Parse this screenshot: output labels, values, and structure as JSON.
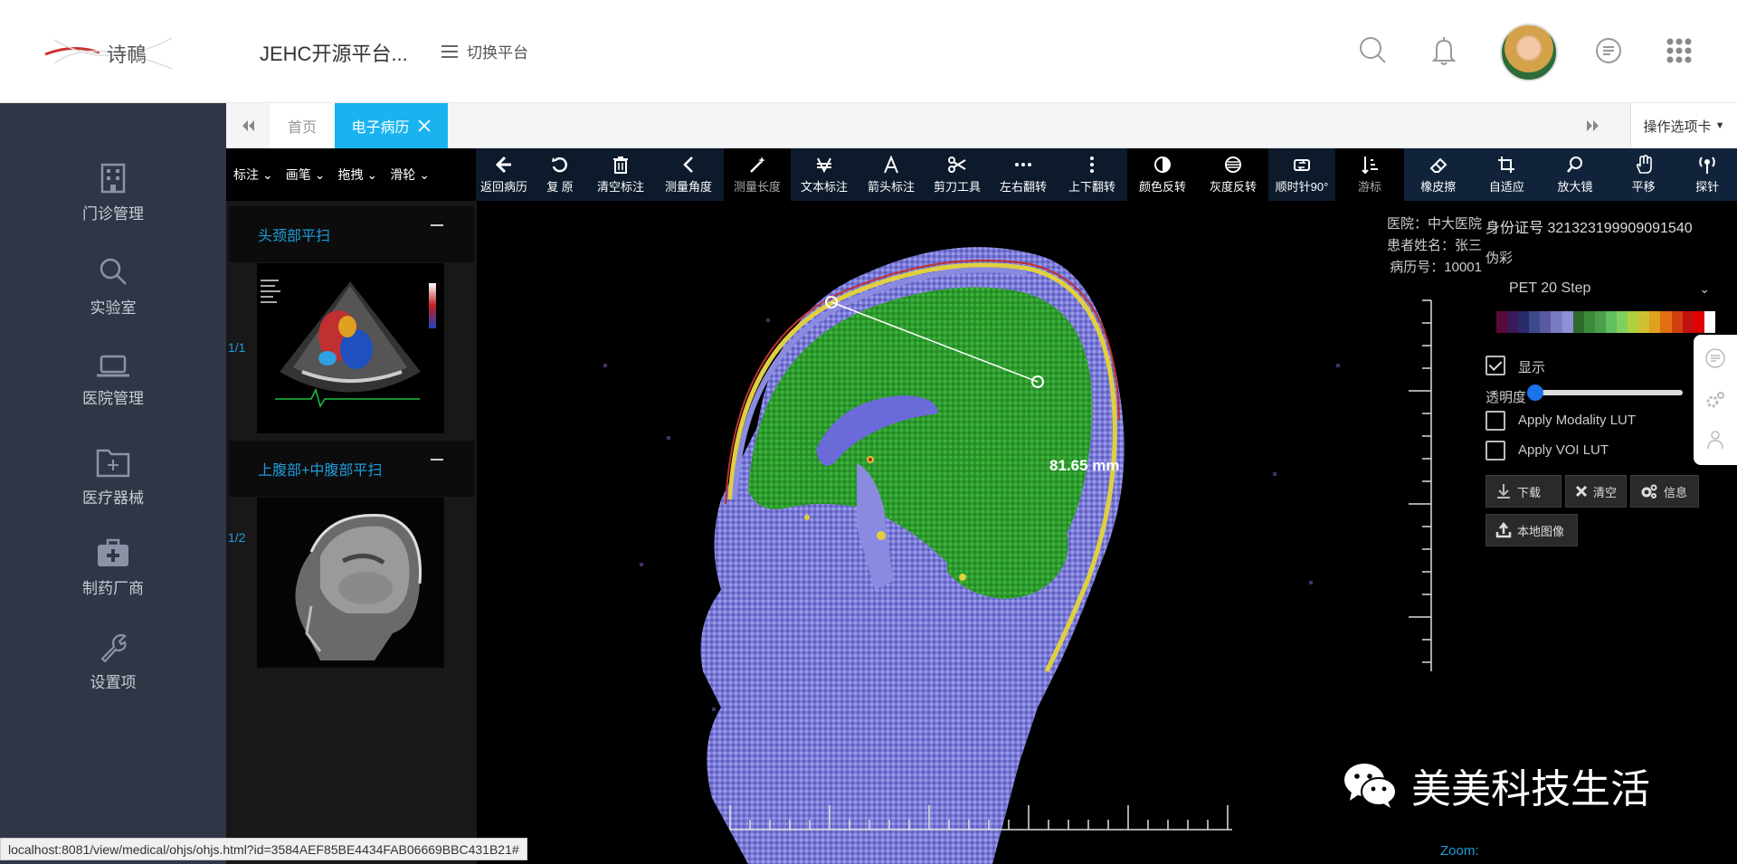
{
  "app": {
    "title": "JEHC开源平台...",
    "switch_label": "切换平台"
  },
  "sidebar": {
    "items": [
      {
        "label": "门诊管理",
        "icon": "building-icon"
      },
      {
        "label": "实验室",
        "icon": "search-icon"
      },
      {
        "label": "医院管理",
        "icon": "laptop-icon"
      },
      {
        "label": "医疗器械",
        "icon": "folder-icon"
      },
      {
        "label": "制药厂商",
        "icon": "medkit-icon"
      },
      {
        "label": "设置项",
        "icon": "wrench-icon"
      }
    ]
  },
  "tabs": {
    "home": "首页",
    "active": "电子病历",
    "ops": "操作选项卡"
  },
  "toolbar": {
    "dropdowns": [
      "标注",
      "画笔",
      "拖拽",
      "滑轮"
    ],
    "tools": [
      {
        "label": "返回病历",
        "icon": "arrow-left-icon"
      },
      {
        "label": "复 原",
        "icon": "undo-icon"
      },
      {
        "label": "清空标注",
        "icon": "trash-icon"
      },
      {
        "label": "测量角度",
        "icon": "angle-icon"
      },
      {
        "label": "测量长度",
        "icon": "magic-wand-icon"
      },
      {
        "label": "文本标注",
        "icon": "text-annotation-icon"
      },
      {
        "label": "箭头标注",
        "icon": "letter-a-icon"
      },
      {
        "label": "剪刀工具",
        "icon": "scissors-icon"
      },
      {
        "label": "左右翻转",
        "icon": "dots-horizontal-icon"
      },
      {
        "label": "上下翻转",
        "icon": "dots-vertical-icon"
      },
      {
        "label": "颜色反转",
        "icon": "contrast-icon"
      },
      {
        "label": "灰度反转",
        "icon": "grayscale-icon"
      },
      {
        "label": "顺时针90°",
        "icon": "rotate-icon"
      },
      {
        "label": "游标",
        "icon": "cursor-sort-icon"
      },
      {
        "label": "橡皮擦",
        "icon": "eraser-icon"
      },
      {
        "label": "自适应",
        "icon": "crop-icon"
      },
      {
        "label": "放大镜",
        "icon": "magnifier-icon"
      },
      {
        "label": "平移",
        "icon": "hand-icon"
      },
      {
        "label": "探针",
        "icon": "probe-icon"
      }
    ]
  },
  "series": [
    {
      "title": "头颈部平扫",
      "count": "1/1"
    },
    {
      "title": "上腹部+中腹部平扫",
      "count": "1/2"
    }
  ],
  "viewer": {
    "hospital": "医院：中大医院",
    "patient": "患者姓名：张三",
    "record": "病历号：10001",
    "measurement": "81.65 mm",
    "zoom": "Zoom:"
  },
  "panel": {
    "id_label": "身份证号 321323199909091540",
    "pseudo_color": "伪彩",
    "lut_selected": "PET 20 Step",
    "show_label": "显示",
    "opacity_label": "透明度",
    "modality_lut": "Apply Modality LUT",
    "voi_lut": "Apply VOI LUT",
    "download": "下载",
    "clear": "清空",
    "info": "信息",
    "local_image": "本地图像",
    "colors": [
      "#5a0a3a",
      "#3a1a5a",
      "#2a2a6a",
      "#3a4a8a",
      "#5a5aa0",
      "#7a7ac0",
      "#9090d8",
      "#2a6a2a",
      "#3a8a3a",
      "#4aa04a",
      "#60c060",
      "#80d060",
      "#b0d040",
      "#d0c030",
      "#e0a020",
      "#e07010",
      "#d04010",
      "#c01010",
      "#e00000",
      "#ffffff"
    ]
  },
  "status": {
    "url": "localhost:8081/view/medical/ohjs/ohjs.html?id=3584AEF85BE4434FAB06669BBC431B21#"
  },
  "watermark": {
    "text": "美美科技生活"
  }
}
